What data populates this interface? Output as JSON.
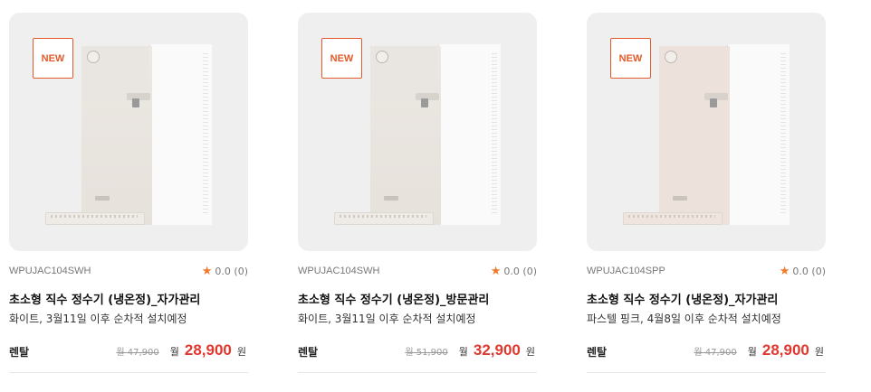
{
  "products": [
    {
      "badge": "NEW",
      "model": "WPUJAC104SWH",
      "rating": "0.0 (0)",
      "title": "초소형 직수 정수기 (냉온정)_자가관리",
      "subtitle": "화이트, 3월11일 이후 순차적 설치예정",
      "type": "렌탈",
      "original_price": "월 47,900",
      "price_prefix": "월",
      "price": "28,900",
      "price_unit": "원",
      "color": "white"
    },
    {
      "badge": "NEW",
      "model": "WPUJAC104SWH",
      "rating": "0.0 (0)",
      "title": "초소형 직수 정수기 (냉온정)_방문관리",
      "subtitle": "화이트, 3월11일 이후 순차적 설치예정",
      "type": "렌탈",
      "original_price": "월 51,900",
      "price_prefix": "월",
      "price": "32,900",
      "price_unit": "원",
      "color": "white"
    },
    {
      "badge": "NEW",
      "model": "WPUJAC104SPP",
      "rating": "0.0 (0)",
      "title": "초소형 직수 정수기 (냉온정)_자가관리",
      "subtitle": "파스텔 핑크, 4월8일 이후 순차적 설치예정",
      "type": "렌탈",
      "original_price": "월 47,900",
      "price_prefix": "월",
      "price": "28,900",
      "price_unit": "원",
      "color": "pink"
    }
  ],
  "icons": {
    "rating": "star-icon"
  },
  "colors": {
    "accent": "#e35a2a",
    "price": "#e0382e",
    "star": "#f0792a"
  }
}
